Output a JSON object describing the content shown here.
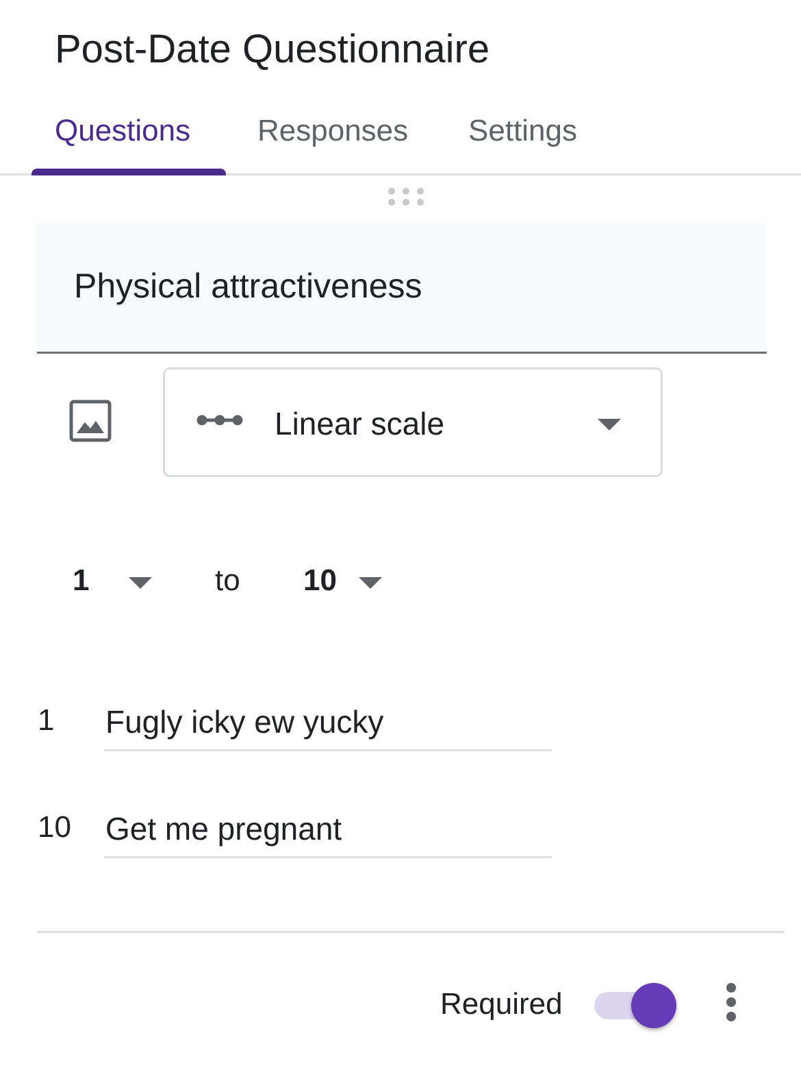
{
  "form": {
    "title": "Post-Date Questionnaire"
  },
  "tabs": [
    {
      "label": "Questions",
      "active": true
    },
    {
      "label": "Responses",
      "active": false
    },
    {
      "label": "Settings",
      "active": false
    }
  ],
  "question": {
    "title": "Physical attractiveness",
    "type": "Linear scale",
    "scale": {
      "min": "1",
      "separator": "to",
      "max": "10"
    },
    "labels": [
      {
        "value": "1",
        "text": "Fugly icky ew yucky"
      },
      {
        "value": "10",
        "text": "Get me pregnant"
      }
    ],
    "required": {
      "label": "Required",
      "on": true
    }
  },
  "icons": {
    "drag": "drag-handle-icon",
    "image": "add-image-icon",
    "type": "linear-scale-icon",
    "dropdown": "dropdown-arrow-icon",
    "more": "more-vert-icon"
  },
  "colors": {
    "accent": "#673ab7",
    "tab_active": "#4a2a8c",
    "toggle_track": "#ddd4f0"
  }
}
